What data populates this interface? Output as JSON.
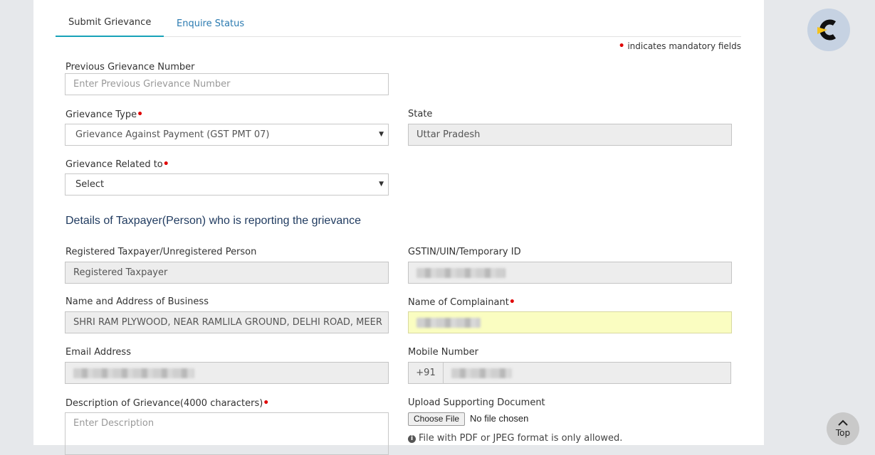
{
  "tabs": [
    {
      "label": "Submit Grievance",
      "active": true
    },
    {
      "label": "Enquire Status",
      "active": false
    }
  ],
  "mandatory_note": "indicates mandatory fields",
  "fields": {
    "prev_grievance": {
      "label": "Previous Grievance Number",
      "placeholder": "Enter Previous Grievance Number"
    },
    "grievance_type": {
      "label": "Grievance Type",
      "value": "Grievance Against Payment (GST PMT 07)"
    },
    "state": {
      "label": "State",
      "value": "Uttar Pradesh"
    },
    "grievance_related": {
      "label": "Grievance Related to",
      "value": "Select"
    },
    "taxpayer_type": {
      "label": "Registered Taxpayer/Unregistered Person",
      "value": "Registered Taxpayer"
    },
    "gstin": {
      "label": "GSTIN/UIN/Temporary ID"
    },
    "business": {
      "label": "Name and Address of Business",
      "value": "SHRI RAM PLYWOOD, NEAR RAMLILA GROUND, DELHI ROAD, MEER"
    },
    "complainant": {
      "label": "Name of Complainant"
    },
    "email": {
      "label": "Email Address"
    },
    "mobile": {
      "label": "Mobile Number",
      "prefix": "+91"
    },
    "description": {
      "label": "Description of Grievance(4000 characters)",
      "placeholder": "Enter Description"
    },
    "upload": {
      "label": "Upload Supporting Document",
      "button": "Choose File",
      "status": "No file chosen",
      "note": "File with PDF or JPEG format is only allowed."
    }
  },
  "section_title": "Details of Taxpayer(Person) who is reporting the grievance",
  "top_button": "Top",
  "colors": {
    "required": "#e00000",
    "tab_accent": "#17a2b8",
    "link": "#2a7ab0",
    "highlight": "#fafdc1"
  },
  "icons": [
    "brand-logo-icon",
    "info-icon",
    "chevron-up-icon",
    "caret-down-icon"
  ]
}
